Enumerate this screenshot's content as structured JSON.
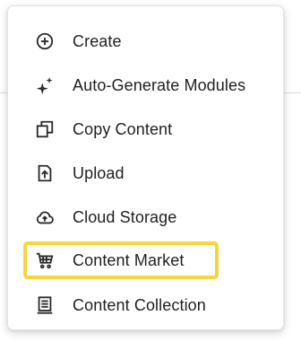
{
  "menu": {
    "items": [
      {
        "label": "Create",
        "icon": "plus-circle-icon"
      },
      {
        "label": "Auto-Generate Modules",
        "icon": "sparkles-icon"
      },
      {
        "label": "Copy Content",
        "icon": "copy-icon"
      },
      {
        "label": "Upload",
        "icon": "upload-icon"
      },
      {
        "label": "Cloud Storage",
        "icon": "cloud-upload-icon"
      },
      {
        "label": "Content Market",
        "icon": "cart-icon",
        "highlighted": true
      },
      {
        "label": "Content Collection",
        "icon": "collection-icon"
      }
    ]
  },
  "colors": {
    "text": "#1f1f1f",
    "icon": "#2b2b2b",
    "highlight_outline": "#f6d53e",
    "menu_border": "#e2e2e2"
  }
}
